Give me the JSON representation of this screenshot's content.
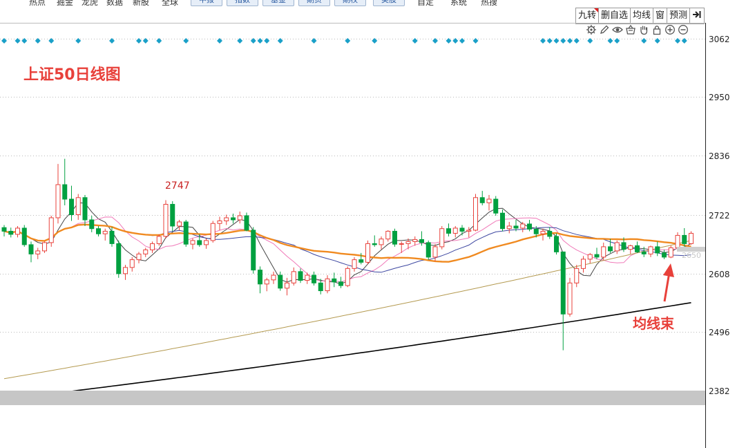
{
  "menu": {
    "items": [
      "热点",
      "掘金",
      "龙虎",
      "数据",
      "新股",
      "全球"
    ],
    "buttons": [
      "中报",
      "指数",
      "基金",
      "期货",
      "期权",
      "美股"
    ],
    "items2": [
      "自定",
      "系统",
      "热搜"
    ]
  },
  "toolbar": {
    "buttons": [
      "九转",
      "删自选",
      "均线",
      "窗",
      "预测"
    ],
    "expand_icon": "arrow-right-bar-icon"
  },
  "tool_icons": [
    "gear-icon",
    "pen-icon",
    "eye-icon",
    "basket-icon",
    "hand-icon",
    "lock-icon",
    "plus-circle-icon",
    "minus-circle-icon"
  ],
  "chart_data": {
    "type": "candlestick",
    "title": "上证50日线图",
    "y_axis": {
      "ticks": [
        3062,
        2950,
        2836,
        2722,
        2608,
        2496,
        2382
      ],
      "range": [
        2362,
        3082
      ]
    },
    "peak_label": "2747",
    "annotation": "均线束",
    "ghost_price_label": "2650",
    "colors": {
      "up": "#e8403a",
      "down": "#00a040",
      "grid": "#b9b9b9",
      "signal": "#1aa0c8",
      "ma_orange": "#f08a20",
      "ma_pink": "#f078b8",
      "ma_olive": "#b49a50",
      "ma_navy": "#3c46a0",
      "ma_black": "#000000"
    },
    "candles": [
      [
        2697,
        2702,
        2680,
        2690
      ],
      [
        2690,
        2697,
        2678,
        2684
      ],
      [
        2684,
        2700,
        2678,
        2696
      ],
      [
        2696,
        2702,
        2660,
        2664
      ],
      [
        2664,
        2670,
        2630,
        2646
      ],
      [
        2646,
        2658,
        2636,
        2652
      ],
      [
        2652,
        2670,
        2648,
        2668
      ],
      [
        2668,
        2720,
        2660,
        2716
      ],
      [
        2716,
        2820,
        2705,
        2780
      ],
      [
        2780,
        2830,
        2740,
        2752
      ],
      [
        2752,
        2778,
        2710,
        2722
      ],
      [
        2722,
        2762,
        2712,
        2755
      ],
      [
        2755,
        2760,
        2700,
        2712
      ],
      [
        2712,
        2720,
        2688,
        2695
      ],
      [
        2695,
        2700,
        2680,
        2685
      ],
      [
        2685,
        2695,
        2672,
        2690
      ],
      [
        2690,
        2698,
        2660,
        2666
      ],
      [
        2666,
        2672,
        2600,
        2608
      ],
      [
        2608,
        2625,
        2596,
        2620
      ],
      [
        2620,
        2640,
        2612,
        2635
      ],
      [
        2635,
        2650,
        2628,
        2646
      ],
      [
        2646,
        2658,
        2640,
        2654
      ],
      [
        2654,
        2670,
        2648,
        2666
      ],
      [
        2666,
        2684,
        2662,
        2680
      ],
      [
        2680,
        2750,
        2676,
        2742
      ],
      [
        2742,
        2748,
        2690,
        2700
      ],
      [
        2700,
        2712,
        2692,
        2708
      ],
      [
        2708,
        2712,
        2660,
        2665
      ],
      [
        2665,
        2676,
        2655,
        2672
      ],
      [
        2672,
        2684,
        2660,
        2664
      ],
      [
        2664,
        2676,
        2656,
        2672
      ],
      [
        2672,
        2710,
        2668,
        2705
      ],
      [
        2705,
        2718,
        2692,
        2710
      ],
      [
        2710,
        2722,
        2702,
        2716
      ],
      [
        2716,
        2724,
        2705,
        2712
      ],
      [
        2712,
        2728,
        2705,
        2720
      ],
      [
        2720,
        2726,
        2690,
        2692
      ],
      [
        2692,
        2698,
        2608,
        2615
      ],
      [
        2615,
        2622,
        2570,
        2588
      ],
      [
        2588,
        2600,
        2574,
        2596
      ],
      [
        2596,
        2612,
        2588,
        2605
      ],
      [
        2605,
        2612,
        2575,
        2580
      ],
      [
        2580,
        2600,
        2566,
        2590
      ],
      [
        2590,
        2620,
        2585,
        2612
      ],
      [
        2612,
        2618,
        2590,
        2595
      ],
      [
        2595,
        2610,
        2588,
        2605
      ],
      [
        2605,
        2612,
        2585,
        2590
      ],
      [
        2590,
        2598,
        2568,
        2575
      ],
      [
        2575,
        2605,
        2570,
        2598
      ],
      [
        2598,
        2610,
        2582,
        2592
      ],
      [
        2592,
        2602,
        2580,
        2585
      ],
      [
        2585,
        2622,
        2582,
        2618
      ],
      [
        2618,
        2640,
        2612,
        2635
      ],
      [
        2635,
        2648,
        2626,
        2630
      ],
      [
        2630,
        2672,
        2626,
        2666
      ],
      [
        2666,
        2682,
        2660,
        2664
      ],
      [
        2664,
        2680,
        2655,
        2675
      ],
      [
        2675,
        2692,
        2670,
        2690
      ],
      [
        2690,
        2695,
        2660,
        2665
      ],
      [
        2665,
        2670,
        2648,
        2666
      ],
      [
        2666,
        2676,
        2655,
        2670
      ],
      [
        2670,
        2680,
        2662,
        2674
      ],
      [
        2674,
        2690,
        2662,
        2668
      ],
      [
        2668,
        2672,
        2635,
        2640
      ],
      [
        2640,
        2665,
        2632,
        2660
      ],
      [
        2660,
        2700,
        2655,
        2695
      ],
      [
        2695,
        2705,
        2680,
        2686
      ],
      [
        2686,
        2700,
        2678,
        2696
      ],
      [
        2696,
        2702,
        2682,
        2690
      ],
      [
        2690,
        2698,
        2678,
        2692
      ],
      [
        2692,
        2762,
        2690,
        2755
      ],
      [
        2755,
        2768,
        2740,
        2745
      ],
      [
        2745,
        2760,
        2730,
        2752
      ],
      [
        2752,
        2758,
        2720,
        2725
      ],
      [
        2725,
        2732,
        2690,
        2695
      ],
      [
        2695,
        2708,
        2686,
        2700
      ],
      [
        2700,
        2712,
        2690,
        2696
      ],
      [
        2696,
        2708,
        2688,
        2704
      ],
      [
        2704,
        2712,
        2690,
        2694
      ],
      [
        2694,
        2700,
        2678,
        2685
      ],
      [
        2685,
        2695,
        2672,
        2690
      ],
      [
        2690,
        2698,
        2675,
        2680
      ],
      [
        2680,
        2686,
        2645,
        2650
      ],
      [
        2650,
        2572,
        2460,
        2530
      ],
      [
        2530,
        2600,
        2525,
        2590
      ],
      [
        2590,
        2625,
        2582,
        2618
      ],
      [
        2618,
        2642,
        2610,
        2636
      ],
      [
        2636,
        2648,
        2628,
        2645
      ],
      [
        2645,
        2658,
        2636,
        2640
      ],
      [
        2640,
        2668,
        2634,
        2660
      ],
      [
        2660,
        2675,
        2648,
        2652
      ],
      [
        2652,
        2672,
        2646,
        2668
      ],
      [
        2668,
        2678,
        2650,
        2655
      ],
      [
        2655,
        2664,
        2646,
        2662
      ],
      [
        2662,
        2670,
        2648,
        2650
      ],
      [
        2650,
        2660,
        2640,
        2646
      ],
      [
        2646,
        2662,
        2640,
        2660
      ],
      [
        2660,
        2670,
        2642,
        2648
      ],
      [
        2648,
        2654,
        2636,
        2640
      ],
      [
        2640,
        2662,
        2638,
        2658
      ],
      [
        2658,
        2688,
        2652,
        2682
      ],
      [
        2682,
        2696,
        2660,
        2666
      ],
      [
        2666,
        2690,
        2664,
        2686
      ]
    ],
    "signal_markers": [
      0,
      2,
      3,
      5,
      7,
      11,
      16,
      20,
      21,
      23,
      27,
      32,
      35,
      37,
      38,
      39,
      41,
      46,
      51,
      55,
      61,
      64,
      66,
      67,
      68,
      70,
      80,
      81,
      82,
      83,
      84,
      85,
      87,
      90,
      91,
      95,
      97,
      100,
      101
    ]
  }
}
